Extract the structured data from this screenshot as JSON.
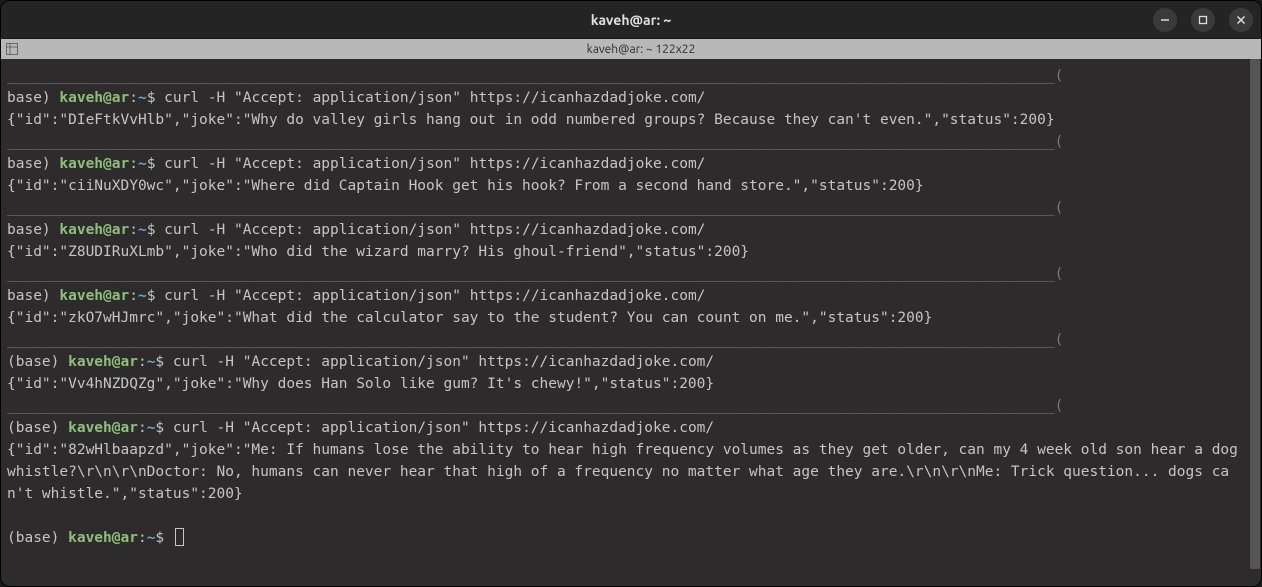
{
  "window": {
    "title": "kaveh@ar: ~"
  },
  "tab": {
    "label": "kaveh@ar: ~ 122x22"
  },
  "prompt": {
    "base": "base) ",
    "base_full": "(base) ",
    "user": "kaveh@ar",
    "colon": ":",
    "path": "~",
    "dollar": "$ "
  },
  "hr": "________________________________________________________________________________________________________________________(",
  "entries": [
    {
      "cmd": "curl -H \"Accept: application/json\" https://icanhazdadjoke.com/",
      "out": "{\"id\":\"DIeFtkVvHlb\",\"joke\":\"Why do valley girls hang out in odd numbered groups? Because they can't even.\",\"status\":200}",
      "base_trunc": true
    },
    {
      "cmd": "curl -H \"Accept: application/json\" https://icanhazdadjoke.com/",
      "out": "{\"id\":\"ciiNuXDY0wc\",\"joke\":\"Where did Captain Hook get his hook? From a second hand store.\",\"status\":200}",
      "base_trunc": true
    },
    {
      "cmd": "curl -H \"Accept: application/json\" https://icanhazdadjoke.com/",
      "out": "{\"id\":\"Z8UDIRuXLmb\",\"joke\":\"Who did the wizard marry? His ghoul-friend\",\"status\":200}",
      "base_trunc": true
    },
    {
      "cmd": "curl -H \"Accept: application/json\" https://icanhazdadjoke.com/",
      "out": "{\"id\":\"zkO7wHJmrc\",\"joke\":\"What did the calculator say to the student? You can count on me.\",\"status\":200}",
      "base_trunc": true
    },
    {
      "cmd": "curl -H \"Accept: application/json\" https://icanhazdadjoke.com/",
      "out": "{\"id\":\"Vv4hNZDQZg\",\"joke\":\"Why does Han Solo like gum? It's chewy!\",\"status\":200}",
      "base_trunc": false
    },
    {
      "cmd": "curl -H \"Accept: application/json\" https://icanhazdadjoke.com/",
      "out": "{\"id\":\"82wHlbaapzd\",\"joke\":\"Me: If humans lose the ability to hear high frequency volumes as they get older, can my 4 week old son hear a dog whistle?\\r\\n\\r\\nDoctor: No, humans can never hear that high of a frequency no matter what age they are.\\r\\n\\r\\nMe: Trick question... dogs can't whistle.\",\"status\":200}",
      "base_trunc": false
    }
  ]
}
